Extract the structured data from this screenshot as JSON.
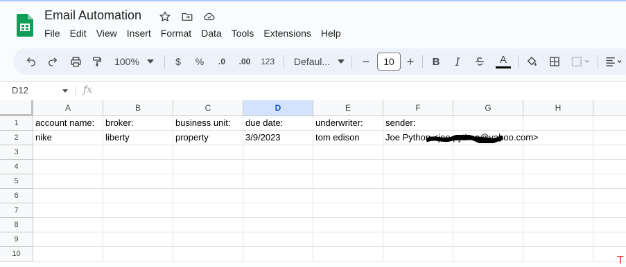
{
  "doc": {
    "title": "Email Automation"
  },
  "menu": [
    "File",
    "Edit",
    "View",
    "Insert",
    "Format",
    "Data",
    "Tools",
    "Extensions",
    "Help"
  ],
  "toolbar": {
    "zoom": "100%",
    "currency": "$",
    "percent": "%",
    "decrease_decimal": ".0",
    "increase_decimal": ".00",
    "number_format": "123",
    "font": "Defaul...",
    "font_size": "10",
    "bold": "B",
    "italic": "I",
    "text_color": "A"
  },
  "formula_bar": {
    "name_box": "D12",
    "fx": "fx",
    "value": ""
  },
  "grid": {
    "selected_column": "D",
    "columns": [
      "A",
      "B",
      "C",
      "D",
      "E",
      "F",
      "G",
      "H"
    ],
    "rows": [
      "1",
      "2",
      "3",
      "4",
      "5",
      "6",
      "7",
      "8",
      "9",
      "10"
    ],
    "cells": {
      "r1": [
        "account name:",
        "broker:",
        "business unit:",
        "due date:",
        "underwriter:",
        "sender:",
        "",
        ""
      ],
      "r2": [
        "nike",
        "liberty",
        "property",
        "3/9/2023",
        "tom edison",
        "Joe Python <joe.python@yahoo.com>",
        "",
        ""
      ]
    }
  },
  "colors": {
    "selected_header": "#d3e3fd",
    "accent": "#0b57d0",
    "sheets_green": "#0f9d58"
  }
}
